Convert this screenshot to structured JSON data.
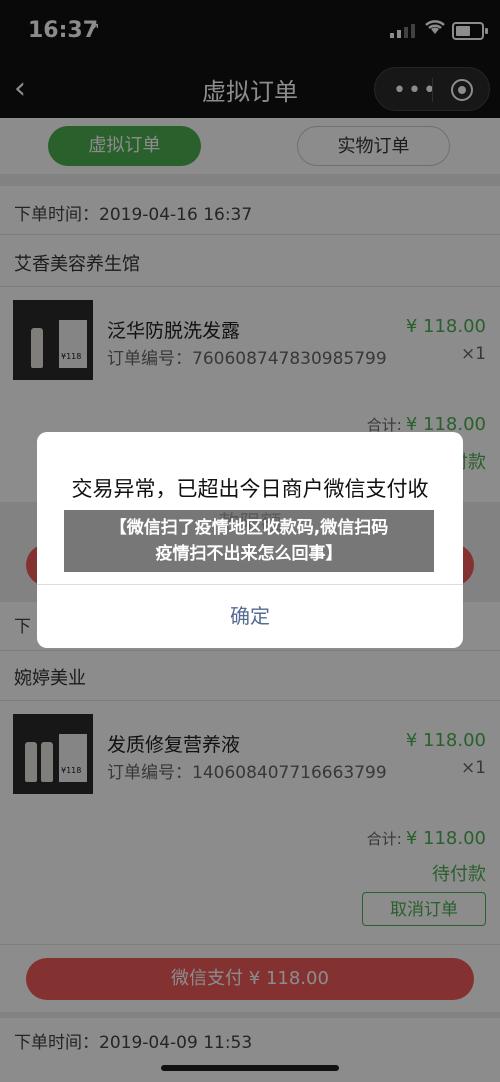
{
  "status_bar": {
    "time": "16:37",
    "location_arrow": "↗",
    "signal_icon": "signal-icon",
    "wifi_icon": "wifi-icon",
    "battery_icon": "battery-icon"
  },
  "nav": {
    "back_icon": "‹",
    "title": "虚拟订单",
    "more_icon": "•••"
  },
  "tabs": [
    {
      "label": "虚拟订单",
      "active": true
    },
    {
      "label": "实物订单",
      "active": false
    }
  ],
  "orders": [
    {
      "time_label": "下单时间：",
      "time": "2019-04-16 16:37",
      "shop": "艾香美容养生馆",
      "product_name": "泛华防脱洗发露",
      "price": "¥ 118.00",
      "order_no_label": "订单编号：",
      "order_no": "760608747830985799",
      "qty": "×1",
      "total_label": "合计:",
      "total": "¥ 118.00",
      "status": "待付款"
    },
    {
      "time_label": "下",
      "shop": "婉婷美业",
      "product_name": "发质修复营养液",
      "price": "¥ 118.00",
      "order_no_label": "订单编号：",
      "order_no": "140608407716663799",
      "qty": "×1",
      "total_label": "合计:",
      "total": "¥ 118.00",
      "status": "待付款",
      "cancel_label": "取消订单",
      "pay_label": "微信支付 ¥ 118.00"
    },
    {
      "time_label": "下单时间：",
      "time": "2019-04-09 11:53"
    }
  ],
  "thumb_price": "¥118",
  "dialog": {
    "message": "交易异常，已超出今日商户微信支付收款限额",
    "ok_label": "确定"
  },
  "banner": {
    "line1": "【微信扫了疫情地区收款码,微信扫码",
    "line2": "疫情扫不出来怎么回事】"
  },
  "colors": {
    "accent_green": "#4caf50",
    "pay_red": "#f15a5a",
    "dialog_link": "#576b95"
  }
}
